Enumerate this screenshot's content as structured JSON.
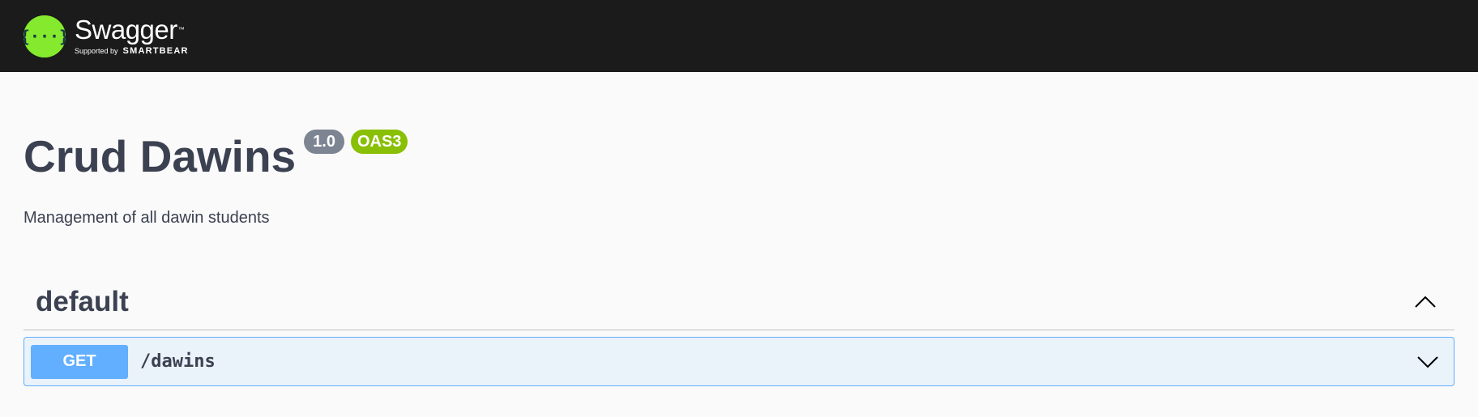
{
  "topbar": {
    "logo_name": "Swagger",
    "logo_tm": "™",
    "supported_by": "Supported by",
    "brand": "SMARTBEAR",
    "logo_color": "#85ea2d",
    "logo_icon": "swagger-logo-icon"
  },
  "info": {
    "title": "Crud Dawins",
    "version": "1.0",
    "oas_badge": "OAS3",
    "description": "Management of all dawin students"
  },
  "tags": [
    {
      "name": "default",
      "toggle_icon": "chevron-up-icon",
      "operations": [
        {
          "method": "GET",
          "path": "/dawins",
          "toggle_icon": "chevron-down-icon"
        }
      ]
    }
  ],
  "colors": {
    "get_method": "#61affe",
    "version_badge": "#7d8492",
    "oas_badge": "#89bf04",
    "topbar_bg": "#1b1b1b"
  }
}
